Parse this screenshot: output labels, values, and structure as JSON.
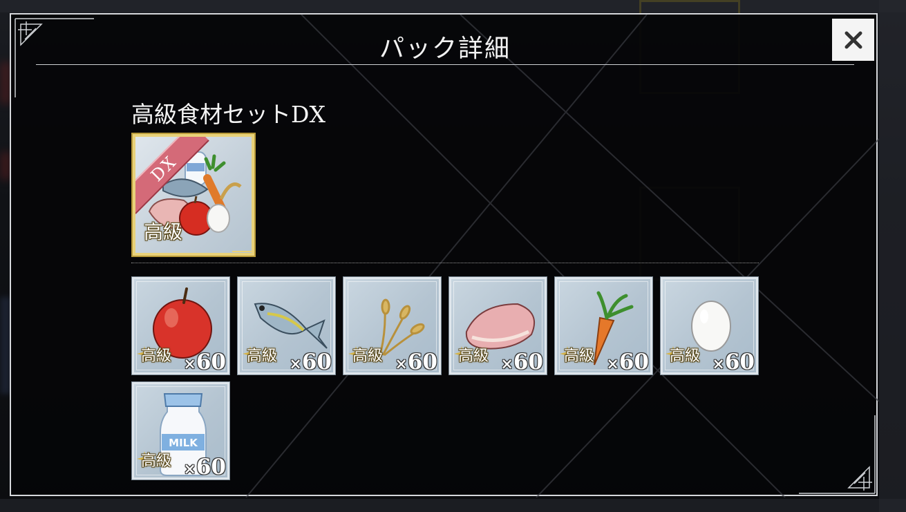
{
  "dialog": {
    "title": "パック詳細",
    "close_label": "✕"
  },
  "pack": {
    "name": "高級食材セットDX",
    "ribbon": "DX",
    "grade": "高級"
  },
  "items": [
    {
      "icon": "apple-icon",
      "grade": "高級",
      "qty_prefix": "×",
      "qty": "60"
    },
    {
      "icon": "fish-icon",
      "grade": "高級",
      "qty_prefix": "×",
      "qty": "60"
    },
    {
      "icon": "wheat-icon",
      "grade": "高級",
      "qty_prefix": "×",
      "qty": "60"
    },
    {
      "icon": "meat-icon",
      "grade": "高級",
      "qty_prefix": "×",
      "qty": "60"
    },
    {
      "icon": "carrot-icon",
      "grade": "高級",
      "qty_prefix": "×",
      "qty": "60"
    },
    {
      "icon": "egg-icon",
      "grade": "高級",
      "qty_prefix": "×",
      "qty": "60"
    },
    {
      "icon": "milk-bottle-icon",
      "grade": "高級",
      "qty_prefix": "×",
      "qty": "60",
      "bottle_text": "MILK"
    }
  ],
  "colors": {
    "modal_border": "#d6d8dc",
    "tile_bg": "#b4c4d1",
    "gold_frame": "#e9d27a",
    "ribbon": "#d46a78"
  }
}
